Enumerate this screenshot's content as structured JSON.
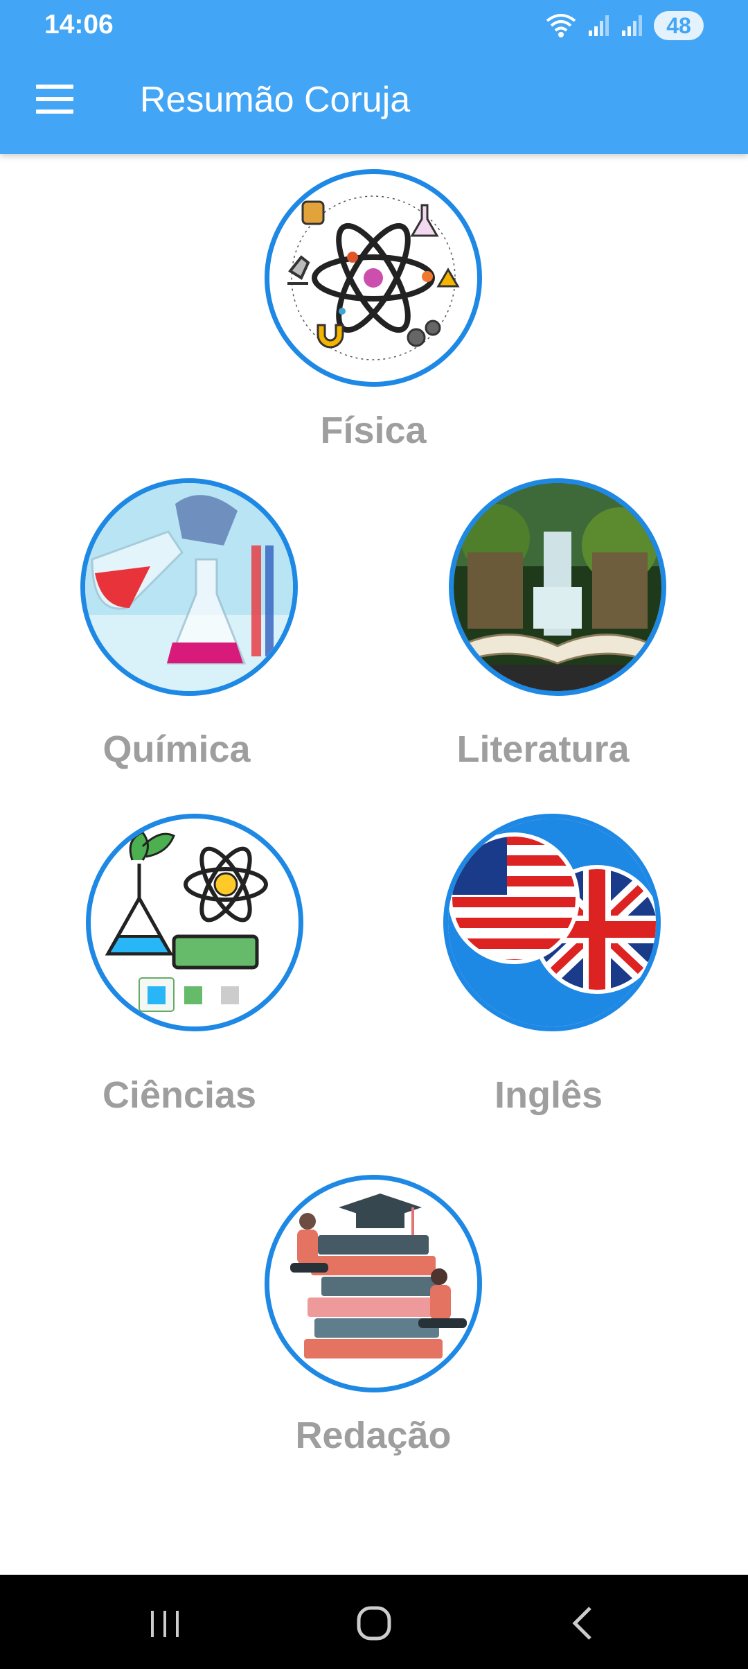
{
  "status_bar": {
    "time": "14:06",
    "battery": "48"
  },
  "app_bar": {
    "title": "Resumão Coruja"
  },
  "subjects": [
    {
      "label": "Física"
    },
    {
      "label": "Química"
    },
    {
      "label": "Literatura"
    },
    {
      "label": "Ciências"
    },
    {
      "label": "Inglês"
    },
    {
      "label": "Redação"
    }
  ],
  "colors": {
    "app_bar": "#42a5f5",
    "circle_border": "#1e88e5",
    "label": "#9e9e9e"
  }
}
